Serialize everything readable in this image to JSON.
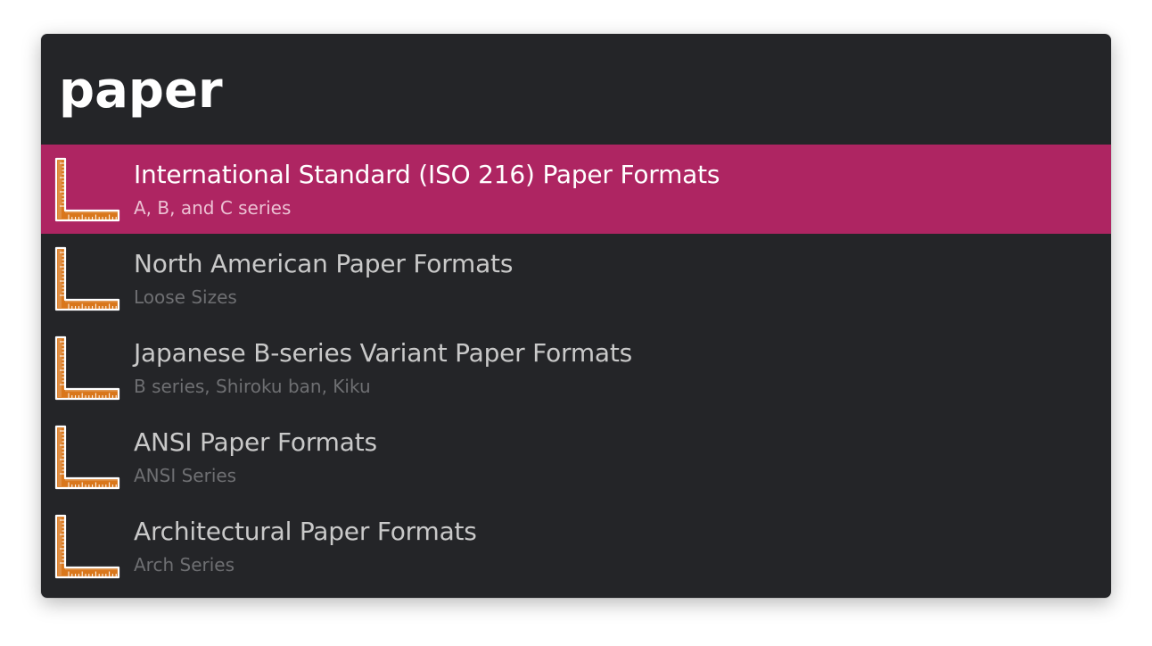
{
  "search": {
    "query": "paper"
  },
  "colors": {
    "window_background": "#242528",
    "selected_row": "#ae2562",
    "title_text": "#c9c9c9",
    "subtitle_text": "#6e6f72",
    "icon_main": "#d9771c",
    "icon_outline": "#ffffff"
  },
  "results": [
    {
      "title": "International Standard (ISO 216) Paper Formats",
      "subtitle": "A, B, and C series",
      "icon": "ruler-square-icon",
      "selected": true
    },
    {
      "title": "North American Paper Formats",
      "subtitle": "Loose Sizes",
      "icon": "ruler-square-icon",
      "selected": false
    },
    {
      "title": "Japanese B-series Variant Paper Formats",
      "subtitle": "B series, Shiroku ban, Kiku",
      "icon": "ruler-square-icon",
      "selected": false
    },
    {
      "title": "ANSI Paper Formats",
      "subtitle": "ANSI Series",
      "icon": "ruler-square-icon",
      "selected": false
    },
    {
      "title": "Architectural Paper Formats",
      "subtitle": "Arch Series",
      "icon": "ruler-square-icon",
      "selected": false
    }
  ]
}
